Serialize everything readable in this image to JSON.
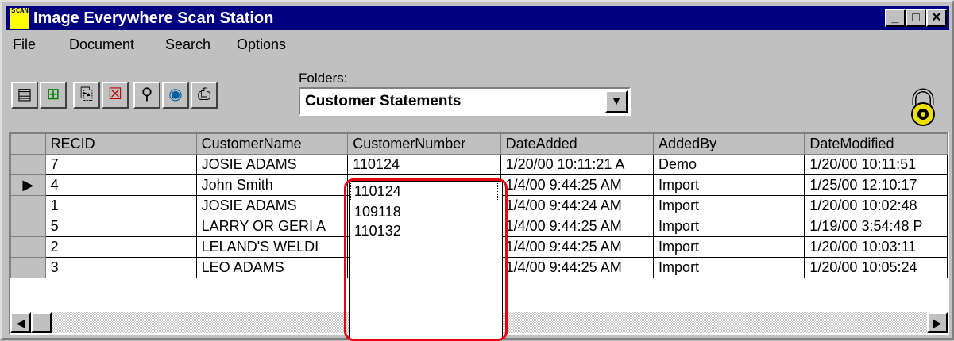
{
  "window": {
    "title": "Image Everywhere Scan Station",
    "icon_text": "SCAN"
  },
  "title_buttons": {
    "minimize": "_",
    "maximize": "□",
    "close": "✕"
  },
  "menu": [
    "File",
    "Document",
    "Search",
    "Options"
  ],
  "toolbar": {
    "tools": [
      "new-document-icon",
      "add-icon",
      "scan-icon",
      "delete-icon",
      "find-icon",
      "web-search-icon",
      "print-icon"
    ],
    "folders_label": "Folders:",
    "folders_value": "Customer Statements"
  },
  "grid": {
    "columns": [
      "RECID",
      "CustomerName",
      "CustomerNumber",
      "DateAdded",
      "AddedBy",
      "DateModified"
    ],
    "rows": [
      [
        "7",
        "JOSIE ADAMS",
        "110124",
        "1/20/00 10:11:21 A",
        "Demo",
        "1/20/00 10:11:51"
      ],
      [
        "4",
        "John Smith",
        "110124",
        "1/4/00 9:44:25 AM",
        "Import",
        "1/25/00 12:10:17"
      ],
      [
        "1",
        "JOSIE ADAMS",
        "",
        "1/4/00 9:44:24 AM",
        "Import",
        "1/20/00 10:02:48"
      ],
      [
        "5",
        "LARRY OR GERI A",
        "",
        "1/4/00 9:44:25 AM",
        "Import",
        "1/19/00 3:54:48 P"
      ],
      [
        "2",
        "LELAND'S WELDI",
        "",
        "1/4/00 9:44:25 AM",
        "Import",
        "1/20/00 10:03:11"
      ],
      [
        "3",
        "LEO ADAMS",
        "",
        "1/4/00 9:44:25 AM",
        "Import",
        "1/20/00 10:05:24"
      ]
    ],
    "current_row_marker": "▶"
  },
  "dropdown": {
    "options": [
      "110124",
      "109118",
      "110132"
    ]
  },
  "colors": {
    "titlebar": "#000080",
    "highlight": "#e8000f",
    "face": "#c0c0c0"
  }
}
